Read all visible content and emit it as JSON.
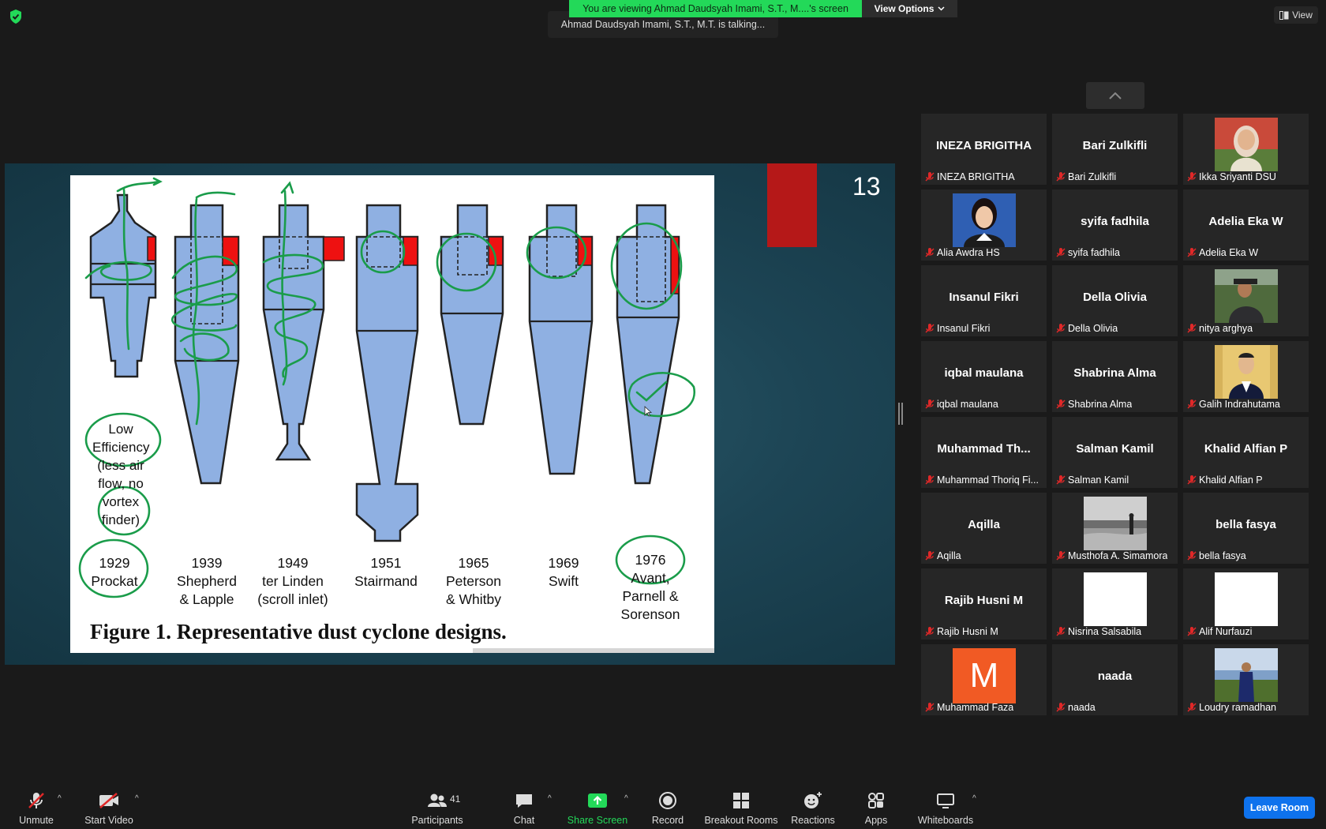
{
  "banner": {
    "text": "You are viewing Ahmad Daudsyah Imami, S.T., M....'s screen",
    "view_options": "View Options"
  },
  "talking_text": "Ahmad Daudsyah Imami, S.T., M.T. is talking...",
  "view_label": "View",
  "slide": {
    "number": "13",
    "caption": "Figure 1. Representative dust cyclone designs.",
    "low_efficiency_note": "Low\nEfficiency\n(less air\nflow, no\nvortex\nfinder)",
    "designs": [
      {
        "label": "1929\nProckat"
      },
      {
        "label": "1939\nShepherd\n& Lapple"
      },
      {
        "label": "1949\nter Linden\n(scroll inlet)"
      },
      {
        "label": "1951\nStairmand"
      },
      {
        "label": "1965\nPeterson\n& Whitby"
      },
      {
        "label": "1969\nSwift"
      },
      {
        "label": "1976\nAvant,\nParnell &\nSorenson"
      }
    ]
  },
  "participants": [
    {
      "name": "INEZA BRIGITHA",
      "display": "INEZA BRIGITHA",
      "video": "none"
    },
    {
      "name": "Bari Zulkifli",
      "display": "Bari Zulkifli",
      "video": "none"
    },
    {
      "name": "Ikka Sriyanti DSU",
      "display": "",
      "video": "photo-hijab"
    },
    {
      "name": "Alia Awdra HS",
      "display": "",
      "video": "photo-portrait"
    },
    {
      "name": "syifa fadhila",
      "display": "syifa fadhila",
      "video": "none"
    },
    {
      "name": "Adelia Eka W",
      "display": "Adelia Eka W",
      "video": "none"
    },
    {
      "name": "Insanul Fikri",
      "display": "Insanul Fikri",
      "video": "none"
    },
    {
      "name": "Della Olivia",
      "display": "Della Olivia",
      "video": "none"
    },
    {
      "name": "nitya arghya",
      "display": "",
      "video": "photo-outdoor"
    },
    {
      "name": "iqbal maulana",
      "display": "iqbal maulana",
      "video": "none"
    },
    {
      "name": "Shabrina Alma",
      "display": "Shabrina Alma",
      "video": "none"
    },
    {
      "name": "Galih Indrahutama",
      "display": "",
      "video": "photo-suit"
    },
    {
      "name": "Muhammad Thoriq Fi...",
      "display": "Muhammad  Th...",
      "video": "none"
    },
    {
      "name": "Salman Kamil",
      "display": "Salman Kamil",
      "video": "none"
    },
    {
      "name": "Khalid Alfian P",
      "display": "Khalid Alfian P",
      "video": "none"
    },
    {
      "name": "Aqilla",
      "display": "Aqilla",
      "video": "none"
    },
    {
      "name": "Musthofa A. Simamora",
      "display": "",
      "video": "photo-beach"
    },
    {
      "name": "bella fasya",
      "display": "bella fasya",
      "video": "none"
    },
    {
      "name": "Rajib Husni M",
      "display": "Rajib Husni M",
      "video": "none"
    },
    {
      "name": "Nisrina Salsabila",
      "display": "",
      "video": "photo-white"
    },
    {
      "name": "Alif Nurfauzi",
      "display": "",
      "video": "photo-white"
    },
    {
      "name": "Muhammad Faza",
      "display": "M",
      "video": "initial"
    },
    {
      "name": "naada",
      "display": "naada",
      "video": "none"
    },
    {
      "name": "Loudry ramadhan",
      "display": "",
      "video": "photo-field"
    }
  ],
  "toolbar": {
    "unmute": "Unmute",
    "start_video": "Start Video",
    "participants": "Participants",
    "participant_count": "41",
    "chat": "Chat",
    "share_screen": "Share Screen",
    "record": "Record",
    "breakout_rooms": "Breakout Rooms",
    "reactions": "Reactions",
    "apps": "Apps",
    "whiteboards": "Whiteboards",
    "leave_room": "Leave Room"
  },
  "colors": {
    "accent_green": "#23d959",
    "leave_blue": "#0e72ed",
    "muted_red": "#e02828",
    "cyclone_blue": "#8fb0e2",
    "annotation_green": "#1a9c4a"
  }
}
